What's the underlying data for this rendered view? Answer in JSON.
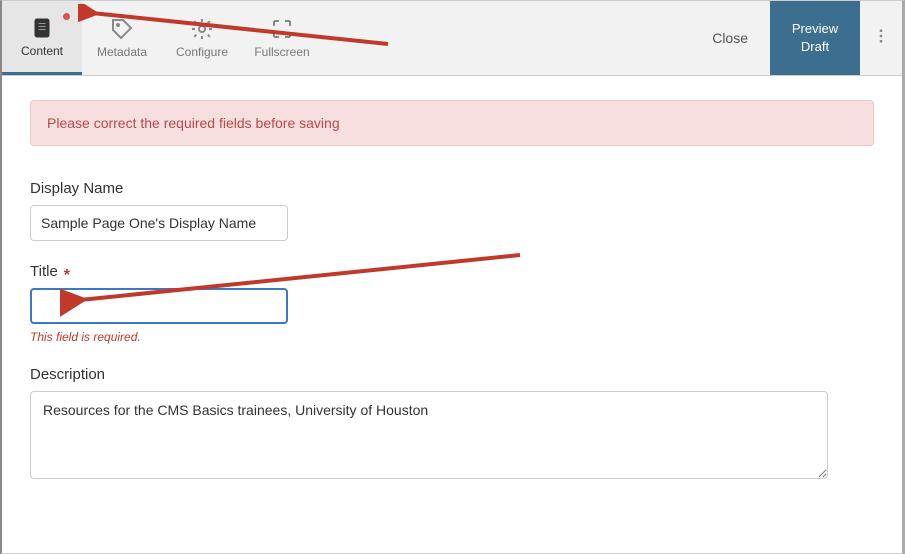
{
  "tabs": {
    "content": "Content",
    "metadata": "Metadata",
    "configure": "Configure",
    "fullscreen": "Fullscreen"
  },
  "actions": {
    "close": "Close",
    "preview_line1": "Preview",
    "preview_line2": "Draft"
  },
  "alert": "Please correct the required fields before saving",
  "fields": {
    "display_name": {
      "label": "Display Name",
      "value": "Sample Page One's Display Name"
    },
    "title": {
      "label": "Title",
      "required_mark": "*",
      "value": "",
      "error": "This field is required."
    },
    "description": {
      "label": "Description",
      "value": "Resources for the CMS Basics trainees, University of Houston"
    }
  }
}
